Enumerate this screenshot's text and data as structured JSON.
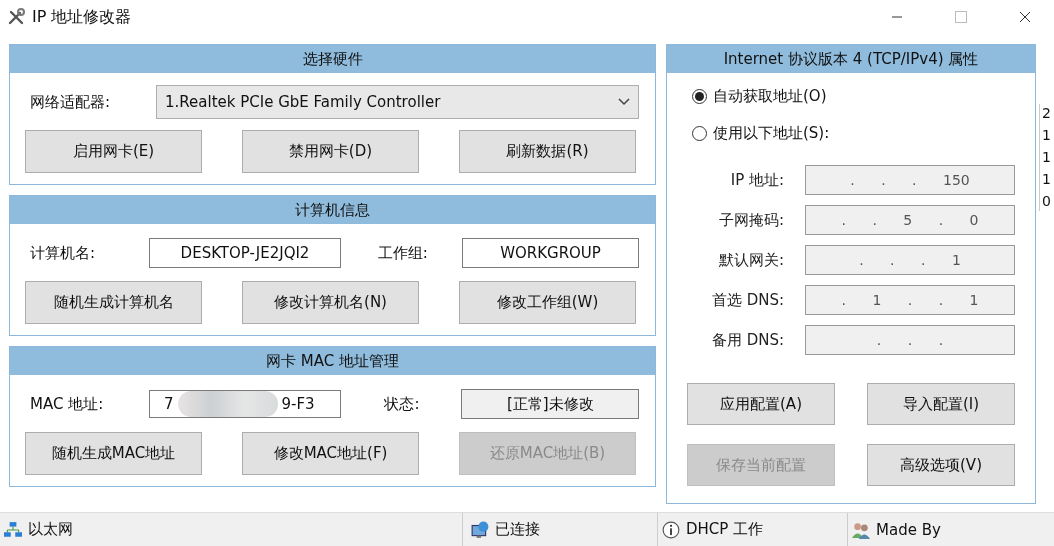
{
  "window": {
    "title": "IP 地址修改器"
  },
  "hardware": {
    "title": "选择硬件",
    "adapter_label": "网络适配器:",
    "adapter": "1.Realtek PCIe GbE Family Controller",
    "buttons": [
      {
        "label": "启用网卡(E)",
        "disabled": false
      },
      {
        "label": "禁用网卡(D)",
        "disabled": false
      },
      {
        "label": "刷新数据(R)",
        "disabled": false
      }
    ]
  },
  "computer": {
    "title": "计算机信息",
    "name_label": "计算机名:",
    "name": "DESKTOP-JE2JQI2",
    "group_label": "工作组:",
    "group": "WORKGROUP",
    "buttons": [
      {
        "label": "随机生成计算机名",
        "disabled": false
      },
      {
        "label": "修改计算机名(N)",
        "disabled": false
      },
      {
        "label": "修改工作组(W)",
        "disabled": false
      }
    ]
  },
  "mac": {
    "title": "网卡 MAC 地址管理",
    "mac_label": "MAC 地址:",
    "mac_parts": [
      "7",
      "9-F3"
    ],
    "status_label": "状态:",
    "status": "[正常]未修改",
    "buttons": [
      {
        "label": "随机生成MAC地址",
        "disabled": false
      },
      {
        "label": "修改MAC地址(F)",
        "disabled": false
      },
      {
        "label": "还原MAC地址(B)",
        "disabled": true
      }
    ]
  },
  "ipv4": {
    "title": "Internet 协议版本 4 (TCP/IPv4) 属性",
    "modes": [
      {
        "label": "自动获取地址(O)",
        "selected": true
      },
      {
        "label": "使用以下地址(S):",
        "selected": false
      }
    ],
    "fields": [
      {
        "label": "IP 地址:",
        "disabled": true,
        "value": ". . . 150"
      },
      {
        "label": "子网掩码:",
        "disabled": true,
        "value": ". . 5 . 0"
      },
      {
        "label": "默认网关:",
        "disabled": true,
        "value": ". . . 1"
      },
      {
        "label": "首选 DNS:",
        "disabled": true,
        "value": ". 1 . . 1"
      },
      {
        "label": "备用 DNS:",
        "disabled": true,
        "value": ". . ."
      }
    ],
    "buttons": [
      {
        "label": "应用配置(A)",
        "disabled": false
      },
      {
        "label": "导入配置(I)",
        "disabled": false
      },
      {
        "label": "保存当前配置",
        "disabled": true
      },
      {
        "label": "高级选项(V)",
        "disabled": false
      }
    ]
  },
  "status_bar": [
    {
      "kind": "network",
      "text": "以太网"
    },
    {
      "kind": "globe",
      "text": "已连接"
    },
    {
      "kind": "info",
      "text": "DHCP 工作"
    },
    {
      "kind": "users",
      "text": "Made By"
    }
  ],
  "background_window": {
    "lines": [
      "2",
      "1",
      "1",
      "1",
      "0"
    ]
  }
}
